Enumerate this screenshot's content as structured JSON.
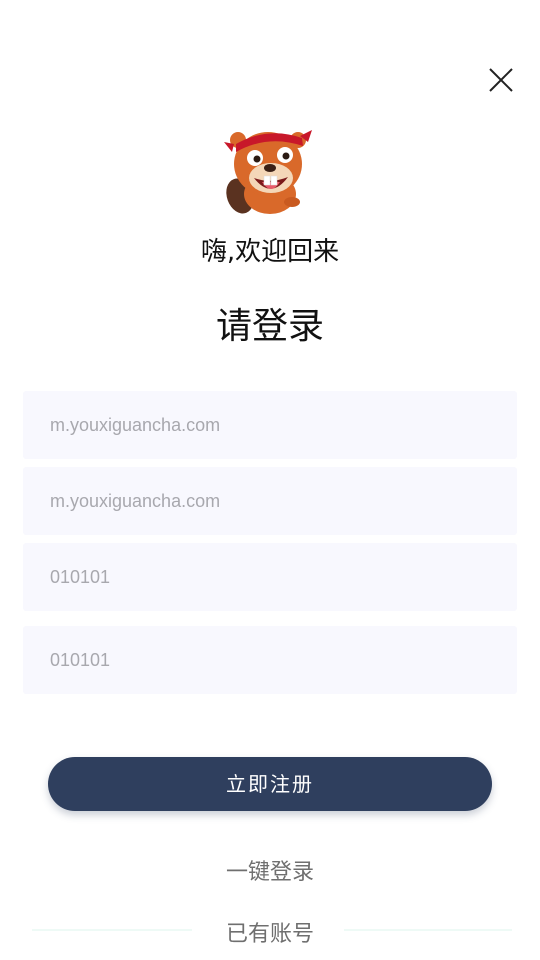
{
  "header": {
    "close_icon": "close-icon",
    "mascot_icon": "beaver-mascot-icon"
  },
  "greeting": "嗨,欢迎回来",
  "title": "请登录",
  "form": {
    "field1_placeholder": "m.youxiguancha.com",
    "field2_placeholder": "m.youxiguancha.com",
    "field3_placeholder": "010101",
    "field4_placeholder": "010101"
  },
  "actions": {
    "register_label": "立即注册",
    "quick_login_label": "一键登录",
    "have_account_label": "已有账号"
  },
  "colors": {
    "primary_button": "#2f3f5e",
    "field_background": "#f8f8fe",
    "mascot_fur": "#d9692a",
    "headband": "#c8182a"
  }
}
